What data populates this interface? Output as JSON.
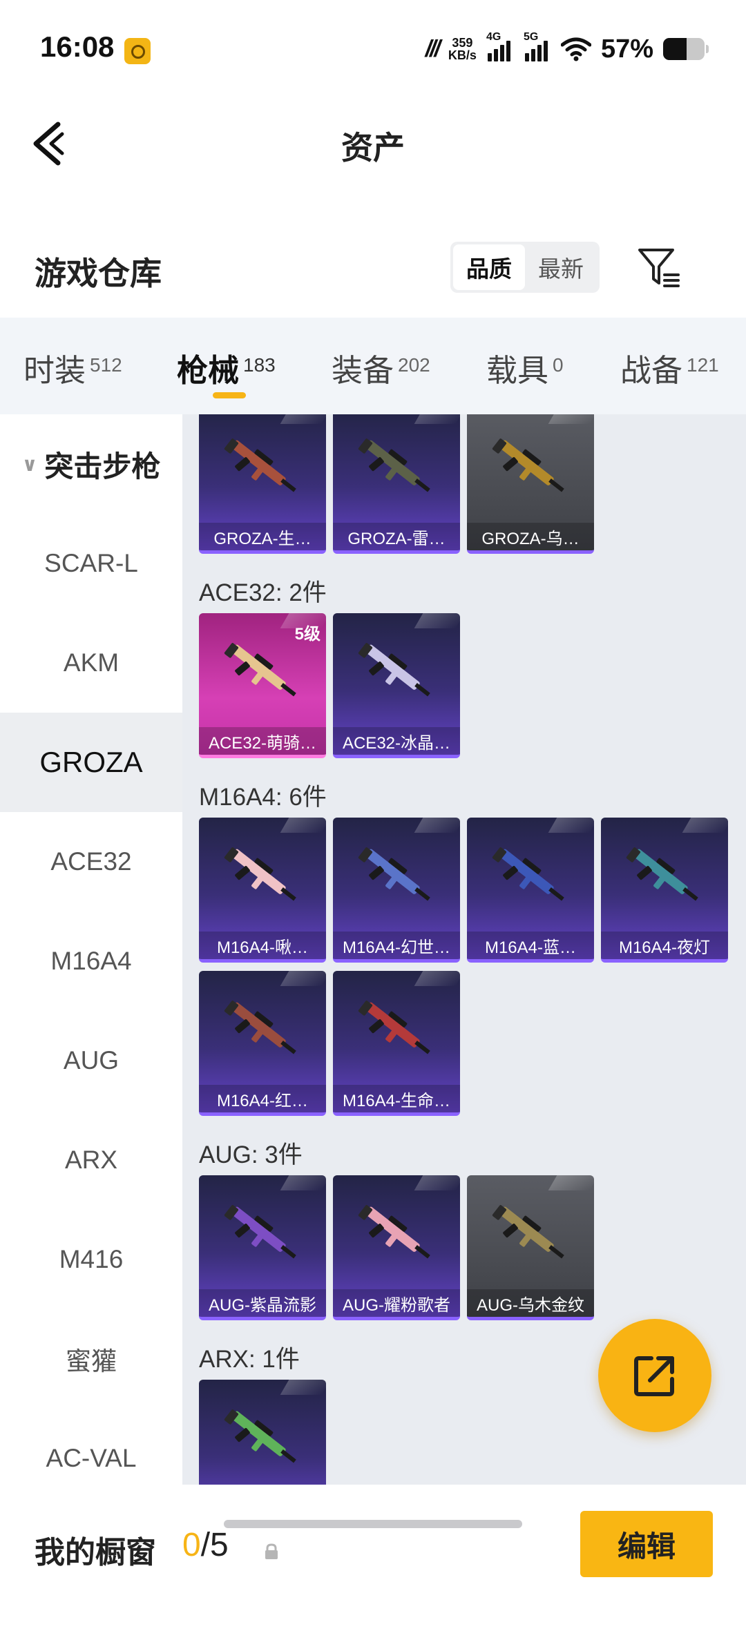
{
  "status_bar": {
    "time": "16:08",
    "net_speed_value": "359",
    "net_speed_unit": "KB/s",
    "net1": "4G",
    "net2": "5G",
    "battery": "57%"
  },
  "header": {
    "title": "资产"
  },
  "warehouse": {
    "title": "游戏仓库",
    "sort_options": [
      "品质",
      "最新"
    ],
    "active_sort": "品质"
  },
  "tabs": [
    {
      "label": "时装",
      "count": "512"
    },
    {
      "label": "枪械",
      "count": "183"
    },
    {
      "label": "装备",
      "count": "202"
    },
    {
      "label": "载具",
      "count": "0"
    },
    {
      "label": "战备",
      "count": "121"
    }
  ],
  "active_tab": "枪械",
  "sidebar": {
    "category": "突击步枪",
    "items": [
      "SCAR-L",
      "AKM",
      "GROZA",
      "ACE32",
      "M16A4",
      "AUG",
      "ARX",
      "M416",
      "蜜獾",
      "AC-VAL"
    ],
    "active": "GROZA"
  },
  "groups": [
    {
      "title": "",
      "cards": [
        {
          "name": "GROZA-生…",
          "tone": "purple",
          "gun_color": "#a8513c"
        },
        {
          "name": "GROZA-雷…",
          "tone": "purple",
          "gun_color": "#5c6148"
        },
        {
          "name": "GROZA-乌…",
          "tone": "gray",
          "gun_color": "#b38a2a"
        }
      ]
    },
    {
      "title": "ACE32: 2件",
      "cards": [
        {
          "name": "ACE32-萌骑…",
          "tone": "pink",
          "gun_color": "#e6c58f",
          "level": "5级"
        },
        {
          "name": "ACE32-冰晶…",
          "tone": "purple",
          "gun_color": "#c9c4e6"
        }
      ]
    },
    {
      "title": "M16A4: 6件",
      "cards": [
        {
          "name": "M16A4-啾…",
          "tone": "purple",
          "gun_color": "#f0c2c6"
        },
        {
          "name": "M16A4-幻世…",
          "tone": "purple",
          "gun_color": "#5a74c9"
        },
        {
          "name": "M16A4-蓝…",
          "tone": "purple",
          "gun_color": "#3c58b8"
        },
        {
          "name": "M16A4-夜灯",
          "tone": "purple",
          "gun_color": "#3e8f9b"
        },
        {
          "name": "M16A4-红…",
          "tone": "purple",
          "gun_color": "#9a4d3e"
        },
        {
          "name": "M16A4-生命…",
          "tone": "purple",
          "gun_color": "#b43a3a"
        }
      ]
    },
    {
      "title": "AUG: 3件",
      "cards": [
        {
          "name": "AUG-紫晶流影",
          "tone": "purple",
          "gun_color": "#7d4ec4"
        },
        {
          "name": "AUG-耀粉歌者",
          "tone": "purple",
          "gun_color": "#e8a3b4"
        },
        {
          "name": "AUG-乌木金纹",
          "tone": "gray",
          "gun_color": "#9c8a52"
        }
      ]
    },
    {
      "title": "ARX: 1件",
      "cards": [
        {
          "name": "",
          "tone": "purple",
          "gun_color": "#5fb35a"
        }
      ]
    }
  ],
  "bottom": {
    "label": "我的橱窗",
    "current": "0",
    "total": "/5",
    "edit": "编辑"
  }
}
